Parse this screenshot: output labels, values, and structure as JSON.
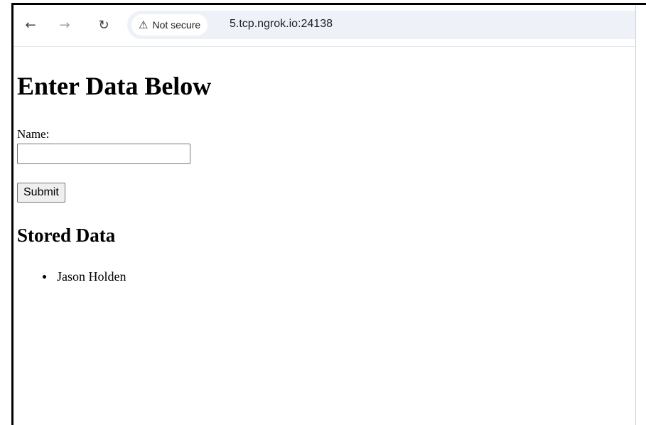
{
  "browser": {
    "back_icon": "arrow-left-icon",
    "forward_icon": "arrow-right-icon",
    "reload_icon": "reload-icon",
    "security_chip": {
      "icon": "warning-triangle-icon",
      "label": "Not secure"
    },
    "url": "5.tcp.ngrok.io:24138"
  },
  "page": {
    "title": "Enter Data Below",
    "form": {
      "name_label": "Name:",
      "name_value": "",
      "submit_label": "Submit"
    },
    "stored": {
      "heading": "Stored Data",
      "items": [
        "Jason Holden"
      ]
    }
  },
  "colors": {
    "omnibox_bg": "#eef2f8",
    "button_bg": "#efefef",
    "text": "#000000"
  }
}
